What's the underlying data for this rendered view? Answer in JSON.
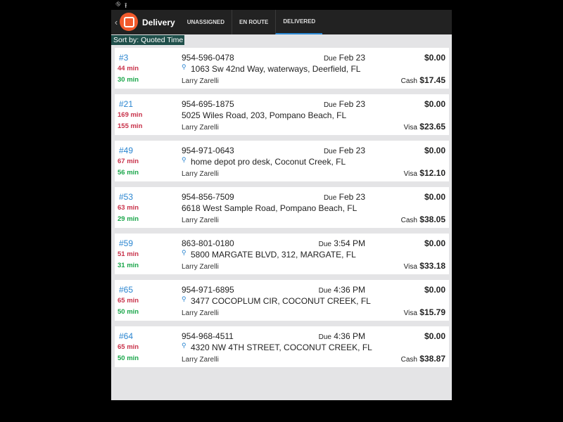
{
  "status_bar": {
    "icons": [
      "usb-icon",
      "upload-icon"
    ]
  },
  "header": {
    "back_glyph": "‹",
    "title": "Delivery",
    "tabs": [
      {
        "label": "UNASSIGNED",
        "active": false
      },
      {
        "label": "EN ROUTE",
        "active": false
      },
      {
        "label": "DELIVERED",
        "active": true
      }
    ]
  },
  "sort_label": "Sort by: Quoted Time",
  "orders": [
    {
      "number": "#3",
      "time1": "44 min",
      "time2": "30 min",
      "phone": "954-596-0478",
      "address": "1063 Sw 42nd Way, waterways, Deerfield, FL",
      "address_icon": true,
      "driver": "Larry Zarelli",
      "due_label": "Due",
      "due": "Feb 23",
      "total": "$0.00",
      "pay_method": "Cash",
      "pay_amount": "$17.45"
    },
    {
      "number": "#21",
      "time1": "169 min",
      "time2": "155 min",
      "phone": "954-695-1875",
      "address": "5025 Wiles Road,  203, Pompano Beach, FL",
      "address_icon": false,
      "driver": "Larry Zarelli",
      "due_label": "Due",
      "due": "Feb 23",
      "total": "$0.00",
      "pay_method": "Visa",
      "pay_amount": "$23.65"
    },
    {
      "number": "#49",
      "time1": "67 min",
      "time2": "56 min",
      "phone": "954-971-0643",
      "address": "home depot pro desk, Coconut Creek, FL",
      "address_icon": true,
      "driver": "Larry Zarelli",
      "due_label": "Due",
      "due": "Feb 23",
      "total": "$0.00",
      "pay_method": "Visa",
      "pay_amount": "$12.10"
    },
    {
      "number": "#53",
      "time1": "63 min",
      "time2": "29 min",
      "phone": "954-856-7509",
      "address": "6618 West Sample Road, Pompano Beach, FL",
      "address_icon": false,
      "driver": "Larry Zarelli",
      "due_label": "Due",
      "due": "Feb 23",
      "total": "$0.00",
      "pay_method": "Cash",
      "pay_amount": "$38.05"
    },
    {
      "number": "#59",
      "time1": "51 min",
      "time2": "31 min",
      "phone": "863-801-0180",
      "address": "5800 MARGATE BLVD, 312, MARGATE, FL",
      "address_icon": true,
      "driver": "Larry Zarelli",
      "due_label": "Due",
      "due": "3:54 PM",
      "total": "$0.00",
      "pay_method": "Visa",
      "pay_amount": "$33.18"
    },
    {
      "number": "#65",
      "time1": "65 min",
      "time2": "50 min",
      "phone": "954-971-6895",
      "address": "3477 COCOPLUM CIR, COCONUT CREEK, FL",
      "address_icon": true,
      "driver": "Larry Zarelli",
      "due_label": "Due",
      "due": "4:36 PM",
      "total": "$0.00",
      "pay_method": "Visa",
      "pay_amount": "$15.79"
    },
    {
      "number": "#64",
      "time1": "65 min",
      "time2": "50 min",
      "phone": "954-968-4511",
      "address": "4320 NW 4TH STREET, COCONUT CREEK, FL",
      "address_icon": true,
      "driver": "Larry Zarelli",
      "due_label": "Due",
      "due": "4:36 PM",
      "total": "$0.00",
      "pay_method": "Cash",
      "pay_amount": "$38.87"
    }
  ],
  "colors": {
    "accent": "#2a85d0",
    "late": "#c8324a",
    "ontime": "#1aa64a",
    "brand": "#f25a2c",
    "sort_bg": "#1f4f4a"
  }
}
